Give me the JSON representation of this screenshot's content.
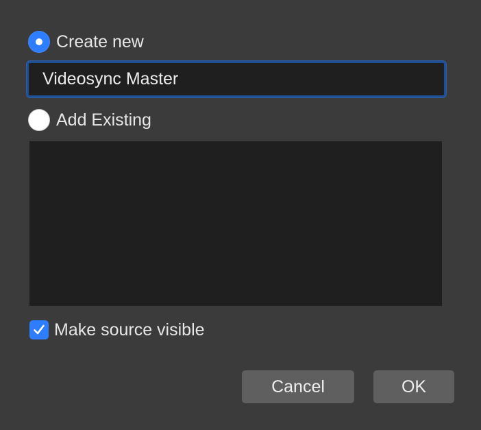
{
  "dialog": {
    "create_new": {
      "label": "Create new",
      "selected": true
    },
    "name_input": {
      "value": "Videosync Master"
    },
    "add_existing": {
      "label": "Add Existing",
      "selected": false
    },
    "existing_sources": {
      "items": []
    },
    "make_visible": {
      "label": "Make source visible",
      "checked": true
    },
    "buttons": {
      "cancel_label": "Cancel",
      "ok_label": "OK"
    }
  },
  "colors": {
    "background": "#3b3b3b",
    "accent": "#2f7dff",
    "input_background": "#1f1f1f",
    "focus_ring": "#1f4f92",
    "button_background": "#5f5f5f",
    "text": "#e6e6e6"
  }
}
